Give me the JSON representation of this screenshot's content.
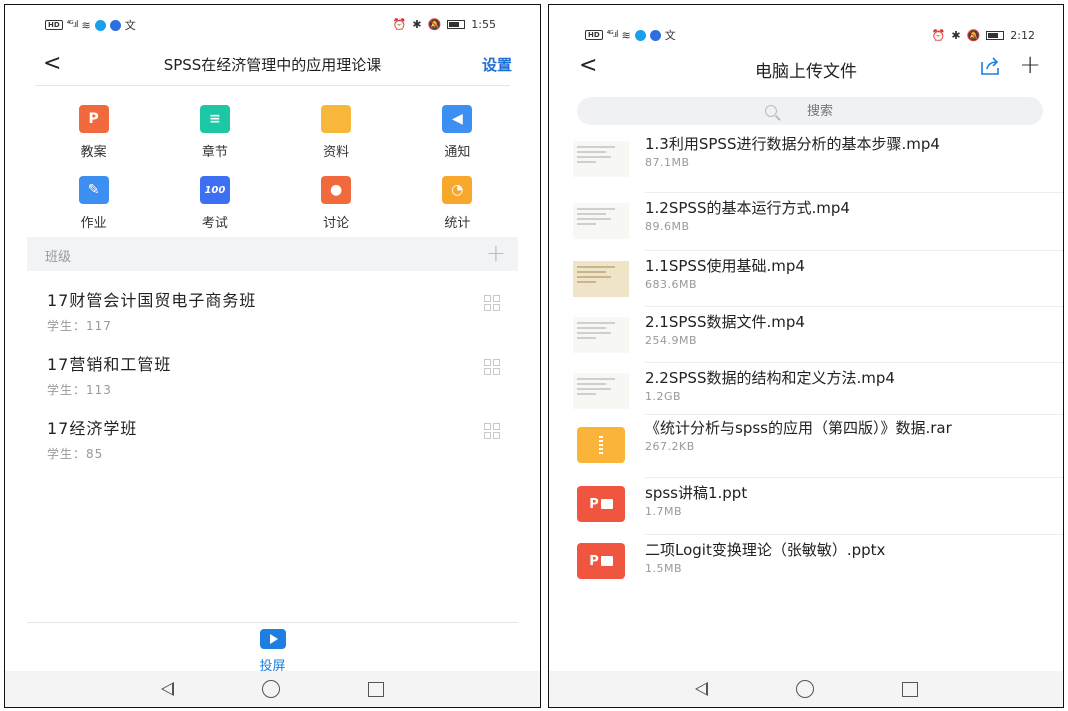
{
  "left": {
    "status": {
      "time": "1:55"
    },
    "header": {
      "back": "<",
      "title": "SPSS在经济管理中的应用理论课",
      "settings": "设置"
    },
    "grid": [
      {
        "label": "教案",
        "icon": "document-p-icon",
        "color": "#f06a3d",
        "glyph": "P"
      },
      {
        "label": "章节",
        "icon": "list-icon",
        "color": "#1dc7a5",
        "glyph": "≡"
      },
      {
        "label": "资料",
        "icon": "folder-icon",
        "color": "#f7b73a",
        "glyph": ""
      },
      {
        "label": "通知",
        "icon": "speaker-icon",
        "color": "#3d8ff2",
        "glyph": "◀"
      },
      {
        "label": "作业",
        "icon": "edit-icon",
        "color": "#3d8ff2",
        "glyph": "✎"
      },
      {
        "label": "考试",
        "icon": "exam-100-icon",
        "color": "#3d6ff2",
        "glyph": "100"
      },
      {
        "label": "讨论",
        "icon": "chat-bubbles-icon",
        "color": "#f06a3d",
        "glyph": "●"
      },
      {
        "label": "统计",
        "icon": "pie-chart-icon",
        "color": "#f7a82a",
        "glyph": "◔"
      }
    ],
    "section": {
      "label": "班级",
      "add": "+"
    },
    "classes": [
      {
        "name": "17财管会计国贸电子商务班",
        "students": "学生：117"
      },
      {
        "name": "17营销和工管班",
        "students": "学生：113"
      },
      {
        "name": "17经济学班",
        "students": "学生：85"
      }
    ],
    "cast_label": "投屏"
  },
  "right": {
    "status": {
      "time": "2:12"
    },
    "header": {
      "back": "<",
      "title": "电脑上传文件",
      "plus": "+"
    },
    "search": {
      "placeholder": "搜索"
    },
    "files": [
      {
        "name": "1.3利用SPSS进行数据分析的基本步骤.mp4",
        "size": "87.1MB",
        "type": "video"
      },
      {
        "name": "1.2SPSS的基本运行方式.mp4",
        "size": "89.6MB",
        "type": "video"
      },
      {
        "name": "1.1SPSS使用基础.mp4",
        "size": "683.6MB",
        "type": "video-tan"
      },
      {
        "name": "2.1SPSS数据文件.mp4",
        "size": "254.9MB",
        "type": "video"
      },
      {
        "name": "2.2SPSS数据的结构和定义方法.mp4",
        "size": "1.2GB",
        "type": "video"
      },
      {
        "name": "《统计分析与spss的应用（第四版）》数据.rar",
        "size": "267.2KB",
        "type": "rar"
      },
      {
        "name": "spss讲稿1.ppt",
        "size": "1.7MB",
        "type": "ppt"
      },
      {
        "name": "二项Logit变换理论（张敏敏）.pptx",
        "size": "1.5MB",
        "type": "ppt"
      }
    ]
  }
}
